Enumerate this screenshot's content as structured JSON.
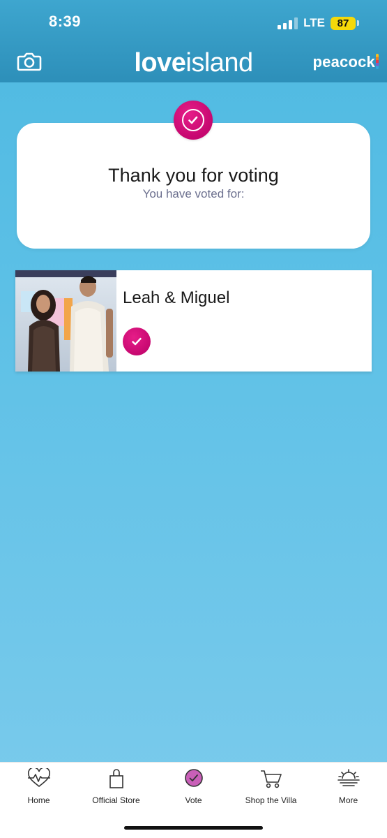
{
  "status_bar": {
    "time": "8:39",
    "network": "LTE",
    "battery": "87",
    "battery_color": "#f5d90a"
  },
  "header": {
    "left_icon": "camera-icon",
    "logo_love": "love",
    "logo_island": "island",
    "partner_logo": "peacock"
  },
  "confirmation": {
    "badge_icon": "check-icon",
    "title": "Thank you for voting",
    "subtitle": "You have voted for:"
  },
  "voted_couple": {
    "name": "Leah & Miguel",
    "photo": "couple-photo",
    "selected_icon": "check-icon"
  },
  "nav": {
    "items": [
      {
        "label": "Home",
        "icon": "heartbeat-icon"
      },
      {
        "label": "Official Store",
        "icon": "shopping-bag-icon"
      },
      {
        "label": "Vote",
        "icon": "vote-check-icon"
      },
      {
        "label": "Shop the Villa",
        "icon": "cart-icon"
      },
      {
        "label": "More",
        "icon": "sunset-icon"
      }
    ],
    "active": "Vote"
  },
  "colors": {
    "background": "#5cc0e6",
    "header": "#2d8fb9",
    "accent": "#d40f7d",
    "card": "#ffffff"
  }
}
